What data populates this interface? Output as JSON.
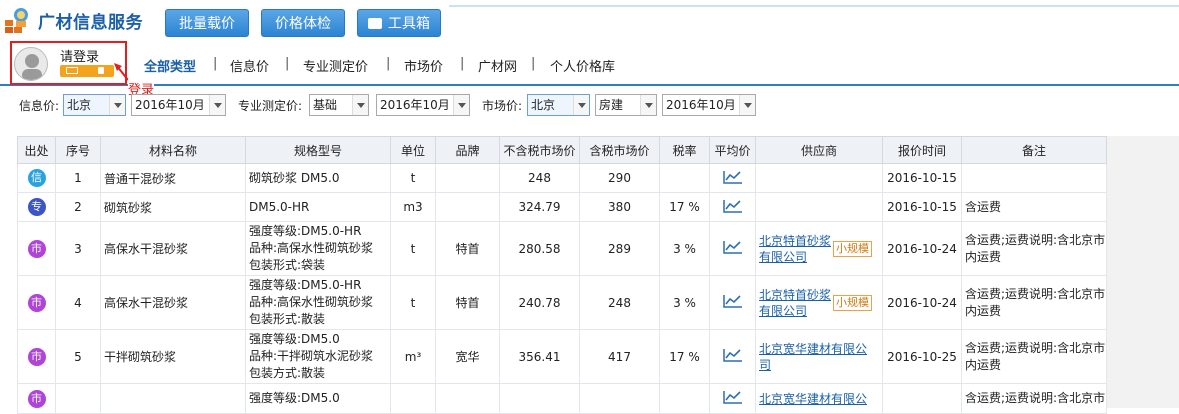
{
  "header": {
    "title": "广材信息服务",
    "buttons": {
      "bulk": "批量载价",
      "check": "价格体检",
      "toolbox": "工具箱"
    }
  },
  "user": {
    "login": "请登录",
    "annotation": "登录"
  },
  "nav": [
    "全部类型",
    "信息价",
    "专业测定价",
    "市场价",
    "广材网",
    "个人价格库"
  ],
  "filters": {
    "info_label": "信息价:",
    "info_city": "北京",
    "info_month": "2016年10月",
    "pro_label": "专业测定价:",
    "pro_type": "基础",
    "pro_month": "2016年10月",
    "market_label": "市场价:",
    "market_city": "北京",
    "market_type": "房建",
    "market_month": "2016年10月"
  },
  "table": {
    "columns": [
      "出处",
      "序号",
      "材料名称",
      "规格型号",
      "单位",
      "品牌",
      "不含税市场价",
      "含税市场价",
      "税率",
      "平均价",
      "供应商",
      "报价时间",
      "备注"
    ],
    "rows": [
      {
        "src": "信",
        "src_color": "#29a3df",
        "no": "1",
        "name": "普通干混砂浆",
        "spec": [
          "砌筑砂浆 DM5.0"
        ],
        "unit": "t",
        "brand": "",
        "ex": "248",
        "inc": "290",
        "tax": "",
        "supplier": [],
        "tag": "",
        "date": "2016-10-15",
        "note": ""
      },
      {
        "src": "专",
        "src_color": "#3b55c9",
        "no": "2",
        "name": "砌筑砂浆",
        "spec": [
          "DM5.0-HR"
        ],
        "unit": "m3",
        "brand": "",
        "ex": "324.79",
        "inc": "380",
        "tax": "17 %",
        "supplier": [],
        "tag": "",
        "date": "2016-10-15",
        "note": "含运费"
      },
      {
        "src": "市",
        "src_color": "#b044d6",
        "no": "3",
        "name": "高保水干混砂浆",
        "spec": [
          "强度等级:DM5.0-HR",
          "品种:高保水性砌筑砂浆",
          "包装形式:袋装"
        ],
        "unit": "t",
        "brand": "特首",
        "ex": "280.58",
        "inc": "289",
        "tax": "3 %",
        "supplier": [
          "北京特首砂浆",
          "有限公司"
        ],
        "tag": "小规模",
        "date": "2016-10-24",
        "note": "含运费;运费说明:含北京市内运费"
      },
      {
        "src": "市",
        "src_color": "#b044d6",
        "no": "4",
        "name": "高保水干混砂浆",
        "spec": [
          "强度等级:DM5.0-HR",
          "品种:高保水性砌筑砂浆",
          "包装形式:散装"
        ],
        "unit": "t",
        "brand": "特首",
        "ex": "240.78",
        "inc": "248",
        "tax": "3 %",
        "supplier": [
          "北京特首砂浆",
          "有限公司"
        ],
        "tag": "小规模",
        "date": "2016-10-24",
        "note": "含运费;运费说明:含北京市内运费"
      },
      {
        "src": "市",
        "src_color": "#b044d6",
        "no": "5",
        "name": "干拌砌筑砂浆",
        "spec": [
          "强度等级:DM5.0",
          "品种:干拌砌筑水泥砂浆",
          "包装方式:散装"
        ],
        "unit": "m³",
        "brand": "宽华",
        "ex": "356.41",
        "inc": "417",
        "tax": "17 %",
        "supplier": [
          "北京宽华建材有限公",
          "司"
        ],
        "tag": "",
        "date": "2016-10-25",
        "note": "含运费;运费说明:含北京市内运费"
      },
      {
        "src": "市",
        "src_color": "#b044d6",
        "no": "",
        "name": "",
        "spec": [
          "强度等级:DM5.0"
        ],
        "unit": "",
        "brand": "",
        "ex": "",
        "inc": "",
        "tax": "",
        "supplier": [
          "北京宽华建材有限公"
        ],
        "tag": "",
        "date": "",
        "note": "含运费;运费说明:含北京市"
      }
    ]
  },
  "colors": {
    "accent": "#2d84d3",
    "title": "#1a5fa8",
    "alert": "#e02020"
  }
}
